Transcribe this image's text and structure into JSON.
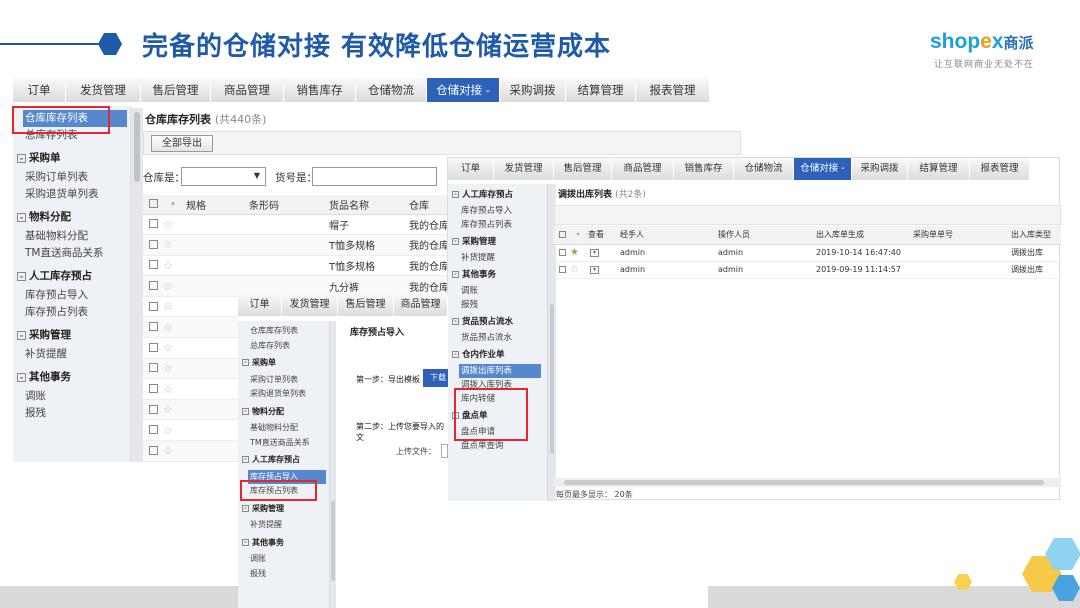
{
  "slide": {
    "title": "完备的仓储对接 有效降低仓储运营成本",
    "brand": {
      "name_latin_1": "shop",
      "name_latin_x": "e",
      "name_latin_2": "x",
      "name_cn": "商派",
      "tagline": "让互联网商业无处不在"
    }
  },
  "nav": {
    "tabs": [
      "订单",
      "发货管理",
      "售后管理",
      "商品管理",
      "销售库存",
      "仓储物流",
      "仓储对接 -",
      "采购调拨",
      "结算管理",
      "报表管理"
    ]
  },
  "window1": {
    "sidebar": {
      "selected": "仓库库存列表",
      "item_after_selected": "总库存列表",
      "groups": [
        {
          "title": "采购单",
          "items": [
            "采购订单列表",
            "采购退货单列表"
          ]
        },
        {
          "title": "物料分配",
          "items": [
            "基础物料分配",
            "TM直送商品关系"
          ]
        },
        {
          "title": "人工库存预占",
          "items": [
            "库存预占导入",
            "库存预占列表"
          ]
        },
        {
          "title": "采购管理",
          "items": [
            "补货提醒"
          ]
        },
        {
          "title": "其他事务",
          "items": [
            "调账",
            "报残"
          ]
        }
      ]
    },
    "list_title": "仓库库存列表",
    "list_count": "(共440条)",
    "export_button": "全部导出",
    "filter_warehouse_label": "仓库是：",
    "filter_sku_label": "货号是：",
    "columns": [
      "规格",
      "条形码",
      "货品名称",
      "仓库"
    ],
    "rows": [
      {
        "name": "帽子",
        "warehouse": "我的仓库"
      },
      {
        "name": "T恤多规格",
        "warehouse": "我的仓库"
      },
      {
        "name": "T恤多规格",
        "warehouse": "我的仓库"
      },
      {
        "name": "九分裤",
        "warehouse": "我的仓库"
      },
      {
        "name": "",
        "warehouse": ""
      },
      {
        "name": "",
        "warehouse": ""
      },
      {
        "name": "",
        "warehouse": ""
      },
      {
        "name": "",
        "warehouse": ""
      },
      {
        "name": "",
        "warehouse": ""
      },
      {
        "name": "",
        "warehouse": ""
      },
      {
        "name": "",
        "warehouse": ""
      },
      {
        "name": "",
        "warehouse": ""
      }
    ]
  },
  "window2": {
    "sidebar": {
      "top_items": [
        "仓库库存列表",
        "总库存列表"
      ],
      "groups": [
        {
          "title": "采购单",
          "items": [
            "采购订单列表",
            "采购退货单列表"
          ]
        },
        {
          "title": "物料分配",
          "items": [
            "基础物料分配",
            "TM直送商品关系"
          ]
        },
        {
          "title": "人工库存预占",
          "items": [
            "库存预占导入",
            "库存预占列表"
          ]
        },
        {
          "title": "采购管理",
          "items": [
            "补货提醒"
          ]
        },
        {
          "title": "其他事务",
          "items": [
            "调账",
            "报残"
          ]
        }
      ],
      "selected": "库存预占导入"
    },
    "page_title": "库存预占导入",
    "step1_label": "第一步：导出模板",
    "step1_button": "下载",
    "step2_label": "第二步：上传您要导入的文",
    "upload_label": "上传文件："
  },
  "window3": {
    "sidebar": {
      "groups": [
        {
          "title": "人工库存预占",
          "items": [
            "库存预占导入",
            "库存预占列表"
          ]
        },
        {
          "title": "采购管理",
          "items": [
            "补货提醒"
          ]
        },
        {
          "title": "其他事务",
          "items": [
            "调账",
            "报残"
          ]
        },
        {
          "title": "货品预占流水",
          "items": [
            "货品预占流水"
          ]
        },
        {
          "title": "仓内作业单",
          "items": [
            "调拨出库列表",
            "调拨入库列表",
            "库内转储"
          ]
        },
        {
          "title": "盘点单",
          "items": [
            "盘点申请",
            "盘点单查询"
          ]
        }
      ],
      "selected": "调拨出库列表"
    },
    "list_title": "调拨出库列表",
    "list_count": "(共2条)",
    "columns": [
      "查看",
      "经手人",
      "操作人员",
      "出入库单生成",
      "采购单单号",
      "出入库类型"
    ],
    "rows": [
      {
        "handler": "admin",
        "operator": "admin",
        "time": "2019-10-14 16:47:40",
        "po": "",
        "type": "调拨出库",
        "starred": true
      },
      {
        "handler": "admin",
        "operator": "admin",
        "time": "2019-09-19 11:14:57",
        "po": "",
        "type": "调拨出库",
        "starred": false
      }
    ],
    "page_size_text": "每页最多显示： 20条"
  },
  "colors": {
    "accent": "#1e5aa8",
    "active_tab": "#2d62b8",
    "highlight": "#e6262d",
    "sidebar_bg": "#eef1f5"
  },
  "icons": [
    "hexagon-bullet-icon",
    "star-icon",
    "checkbox-icon",
    "dropdown-arrow-icon",
    "collapse-icon",
    "view-icon"
  ]
}
